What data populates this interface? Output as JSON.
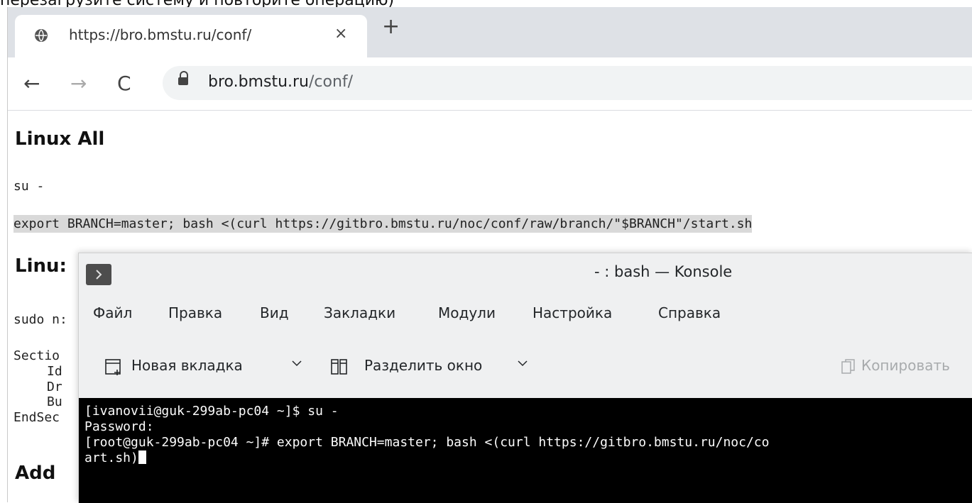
{
  "top_fragment": "перезагрузите систему и повторите операцию)",
  "browser": {
    "tab_title": "https://bro.bmstu.ru/conf/",
    "tab_close": "×",
    "new_tab": "+",
    "nav_back": "←",
    "nav_forward": "→",
    "nav_reload": "C",
    "url_host": "bro.bmstu.ru",
    "url_path": "/conf/"
  },
  "page": {
    "heading_linux_all": "Linux All",
    "su_line": "su -",
    "export_line": "export BRANCH=master; bash <(curl https://gitbro.bmstu.ru/noc/conf/raw/branch/\"$BRANCH\"/start.sh",
    "heading_partial": "Linu:",
    "sudo_partial": "sudo n:",
    "section_partial": "Sectio",
    "id_partial": "Id",
    "dr_partial": "Dr",
    "bu_partial": "Bu",
    "endsec_partial": "EndSec",
    "heading_add_partial": "Add"
  },
  "konsole": {
    "title": "- : bash — Konsole",
    "menu": [
      "Файл",
      "Правка",
      "Вид",
      "Закладки",
      "Модули",
      "Настройка",
      "Справка"
    ],
    "toolbar": {
      "new_tab": "Новая вкладка",
      "split_view": "Разделить окно",
      "copy": "Копировать"
    },
    "terminal_lines": [
      "[ivanovii@guk-299ab-pc04 ~]$ su -",
      "Password:",
      "[root@guk-299ab-pc04 ~]# export BRANCH=master; bash <(curl https://gitbro.bmstu.ru/noc/co",
      "art.sh)"
    ]
  },
  "colors": {
    "tabstrip": "#dee1e6",
    "omnibox": "#f1f3f4",
    "code_highlight": "#d9d9d9",
    "konsole_bg": "#eff0f1",
    "terminal_bg": "#000000",
    "terminal_fg": "#fcfcfc"
  }
}
